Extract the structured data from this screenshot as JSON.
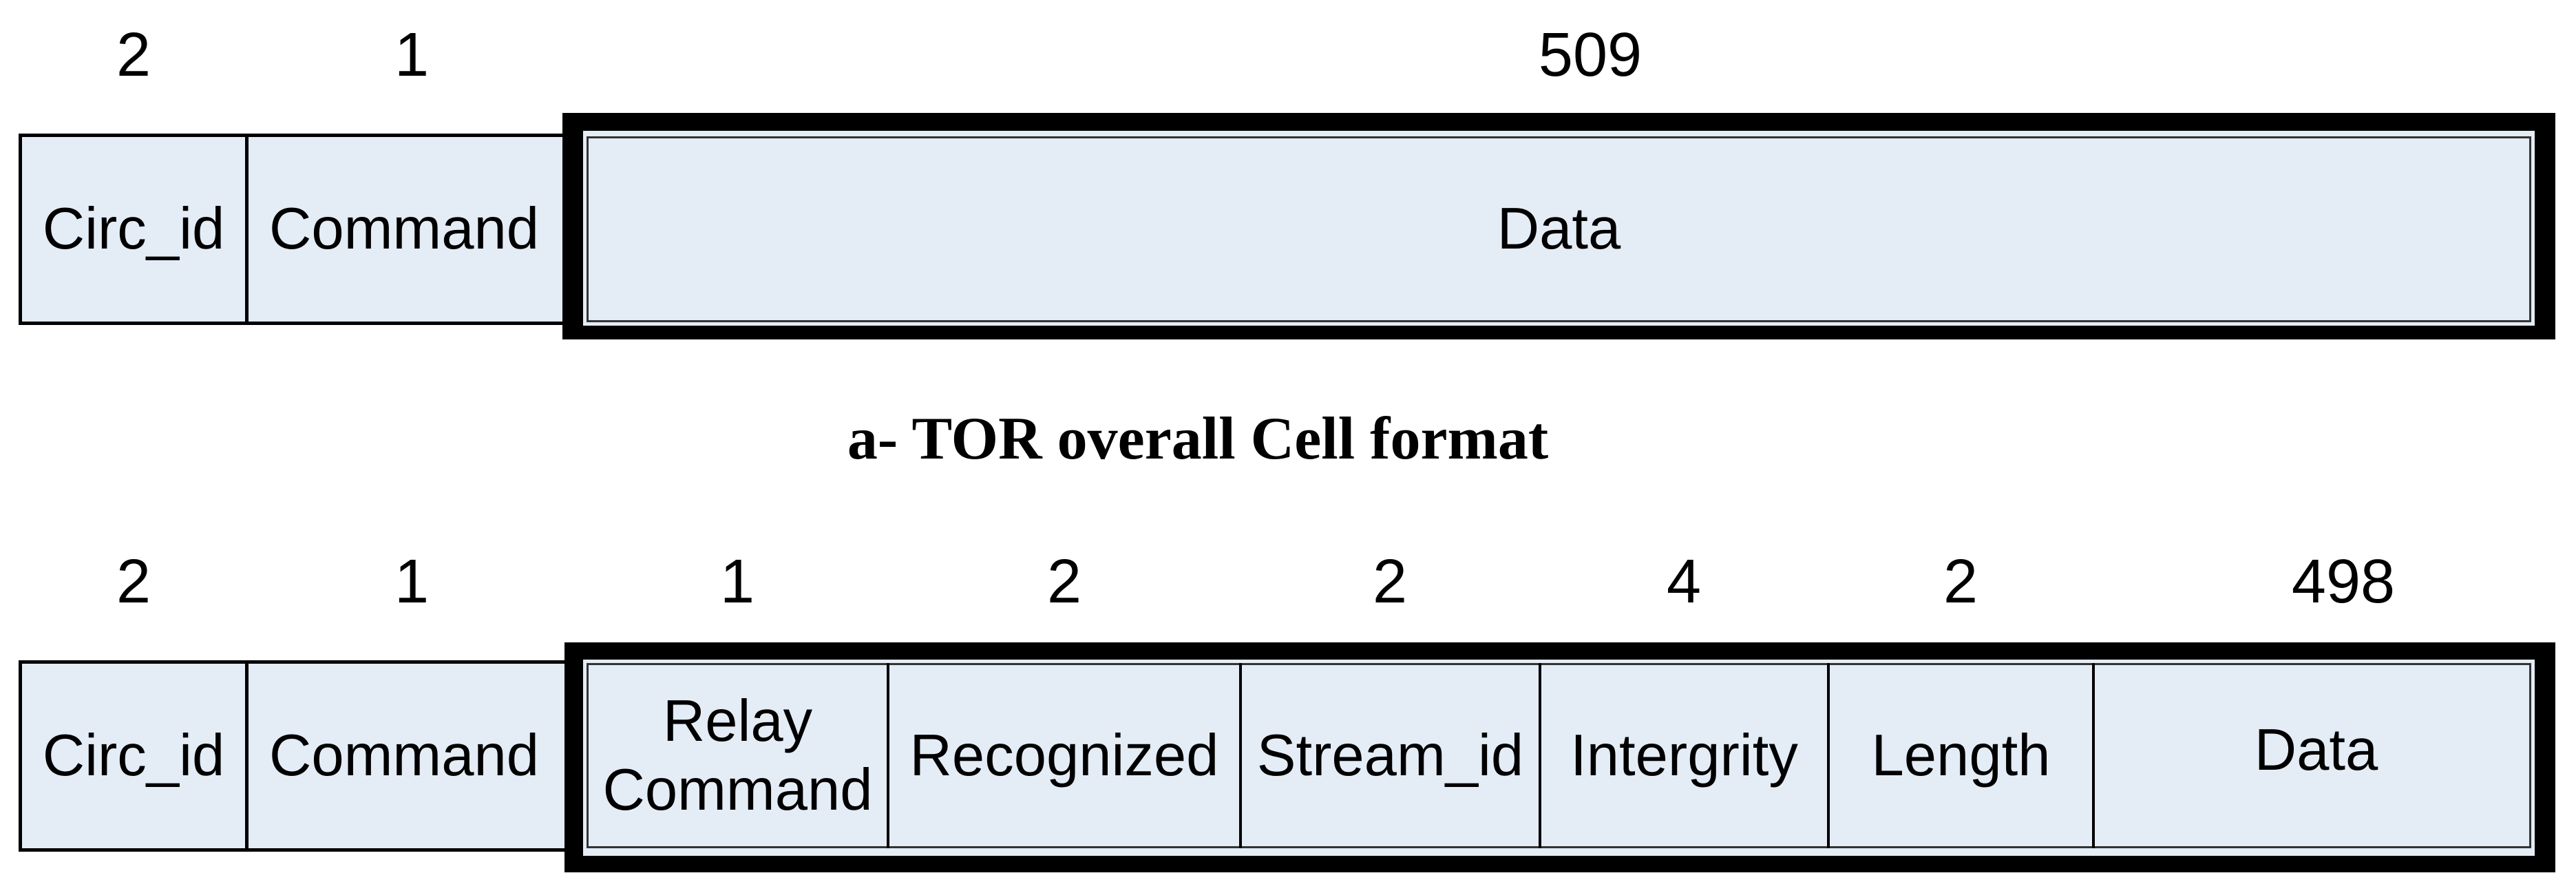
{
  "figure": {
    "top_diagram": {
      "caption": "a- TOR overall Cell format",
      "fields": [
        {
          "name": "Circ_id",
          "size": "2"
        },
        {
          "name": "Command",
          "size": "1"
        },
        {
          "name": "Data",
          "size": "509"
        }
      ]
    },
    "bottom_diagram": {
      "fields": [
        {
          "name": "Circ_id",
          "size": "2"
        },
        {
          "name": "Command",
          "size": "1"
        },
        {
          "name": "Relay Command",
          "line1": "Relay",
          "line2": "Command",
          "size": "1"
        },
        {
          "name": "Recognized",
          "size": "2"
        },
        {
          "name": "Stream_id",
          "size": "2"
        },
        {
          "name": "Intergrity",
          "size": "4"
        },
        {
          "name": "Length",
          "size": "2"
        },
        {
          "name": "Data",
          "size": "498"
        }
      ]
    },
    "colors": {
      "cell_fill": "#e4ecf6",
      "border": "#000000"
    }
  }
}
